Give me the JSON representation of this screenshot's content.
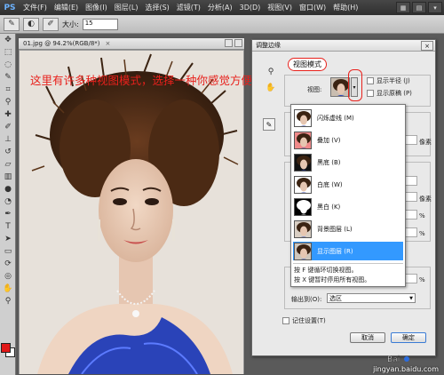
{
  "app": {
    "logo": "PS",
    "menu": [
      "文件(F)",
      "编辑(E)",
      "图像(I)",
      "图层(L)",
      "选择(S)",
      "滤镜(T)",
      "分析(A)",
      "3D(D)",
      "视图(V)",
      "窗口(W)",
      "帮助(H)"
    ]
  },
  "options": {
    "size_label": "大小:",
    "size_value": "15"
  },
  "document": {
    "title": "01.jpg @ 94.2%(RGB/8*)",
    "close": "×"
  },
  "annotation": "这里有许多种视图模式，选择一种你感觉方便的",
  "dialog": {
    "title": "调整边缘",
    "close": "×",
    "view_mode_label": "视图模式",
    "view_label": "视图:",
    "show_radius": "显示半径 (J)",
    "show_original": "显示原稿 (P)",
    "pixels_label": "像素",
    "percent": "%",
    "output_label": "输出到(O):",
    "output_value": "选区",
    "remember": "记住设置(T)",
    "cancel": "取消",
    "ok": "确定"
  },
  "view_options": [
    {
      "label": "闪烁虚线 (M)",
      "bg": "#ffffff"
    },
    {
      "label": "叠加 (V)",
      "bg": "#f08a8a"
    },
    {
      "label": "黑底 (B)",
      "bg": "#111111"
    },
    {
      "label": "白底 (W)",
      "bg": "#ffffff"
    },
    {
      "label": "黑白 (K)",
      "bg": "#000000"
    },
    {
      "label": "背景图层 (L)",
      "bg": "#d9cfc4"
    },
    {
      "label": "显示图层 (R)",
      "bg": "#cccccc"
    }
  ],
  "popup_hints": [
    "按 F 键循环切换视图。",
    "按 X 键暂时停用所有视图。"
  ],
  "watermark": "jingyan.baidu.com",
  "colors": {
    "annotation_red": "#e8211c",
    "selection_blue": "#3399ff",
    "foreground": "#e11717",
    "background": "#ffffff"
  }
}
